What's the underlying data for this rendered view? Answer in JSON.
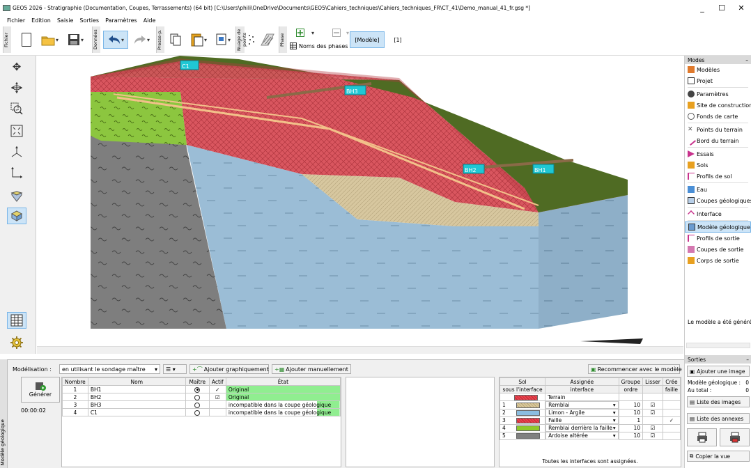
{
  "window": {
    "title": "GEO5 2026 - Stratigraphie (Documentation, Coupes, Terrassements) (64 bit) [C:\\Users\\phili\\OneDrive\\Documents\\GEO5\\Cahiers_techniques\\Cahiers_techniques_FR\\CT_41\\Demo_manual_41_fr.gsg *]",
    "minimize": "_",
    "maximize": "☐",
    "close": "✕"
  },
  "menu": [
    "Fichier",
    "Edition",
    "Saisie",
    "Sorties",
    "Paramètres",
    "Aide"
  ],
  "toolbar": {
    "group_fichier": "Fichier",
    "group_donnees": "Données",
    "group_presse": "Presse-p.",
    "nuage_label": "Nuage de points",
    "group_phase": "Phase",
    "phase_names_label": "Noms des phases",
    "mode_button": "[Modèle]",
    "phase_number": "[1]"
  },
  "view": {
    "boreholes": [
      "C1",
      "BH3",
      "BH2",
      "BH1"
    ]
  },
  "right_panel": {
    "modes_header": "Modes",
    "items": [
      {
        "label": "Modèles",
        "icon": "models-icon"
      },
      {
        "label": "Projet",
        "icon": "project-icon"
      },
      {
        "label": "Paramètres",
        "icon": "gear-icon"
      },
      {
        "label": "Site de construction",
        "icon": "site-icon"
      },
      {
        "label": "Fonds de carte",
        "icon": "map-icon"
      },
      {
        "label": "Points du terrain",
        "icon": "terrain-points-icon"
      },
      {
        "label": "Bord du terrain",
        "icon": "terrain-edge-icon"
      },
      {
        "label": "Essais",
        "icon": "tests-icon"
      },
      {
        "label": "Sols",
        "icon": "soils-icon"
      },
      {
        "label": "Profils de sol",
        "icon": "soil-profiles-icon"
      },
      {
        "label": "Eau",
        "icon": "water-icon"
      },
      {
        "label": "Coupes géologiques",
        "icon": "geological-sections-icon"
      },
      {
        "label": "Interface",
        "icon": "interface-icon"
      },
      {
        "label": "Modèle géologique",
        "icon": "geological-model-icon"
      },
      {
        "label": "Profils de sortie",
        "icon": "output-profiles-icon"
      },
      {
        "label": "Coupes de sortie",
        "icon": "output-sections-icon"
      },
      {
        "label": "Corps de sortie",
        "icon": "output-bodies-icon"
      }
    ],
    "message": "Le modèle a été généré.",
    "sorties_header": "Sorties",
    "add_image": "Ajouter une image",
    "model_label": "Modèle géologique :",
    "model_count": "0",
    "total_label": "Au total :",
    "total_count": "0",
    "image_list": "Liste des images",
    "annex_list": "Liste des annexes",
    "copy_view": "Copier la vue"
  },
  "bottom": {
    "side_tab": "Modèle géologique",
    "generate": "Générer",
    "elapsed": "00:00:02",
    "modelisation_label": "Modélisation :",
    "modelisation_value": "en utilisant le sondage maître",
    "add_graphic": "Ajouter graphiquement",
    "add_manual": "Ajouter manuellement",
    "restart": "Recommencer avec le modèle",
    "boreholes_table": {
      "headers": [
        "Nombre",
        "Nom",
        "Maître",
        "Actif",
        "État"
      ],
      "rows": [
        {
          "n": "1",
          "name": "BH1",
          "master": true,
          "active": "✓",
          "state": "Original"
        },
        {
          "n": "2",
          "name": "BH2",
          "master": false,
          "active": "☑",
          "state": "Original"
        },
        {
          "n": "3",
          "name": "BH3",
          "master": false,
          "active": "",
          "state": "incompatible dans la coupe géologique"
        },
        {
          "n": "4",
          "name": "C1",
          "master": false,
          "active": "",
          "state": "incompatible dans la coupe géologique"
        }
      ]
    },
    "interfaces_table": {
      "headers": [
        "Sol",
        "Assignée",
        "Groupe",
        "Lisser",
        "Crée"
      ],
      "subheaders": [
        "sous l'interface",
        "interface",
        "ordre",
        "",
        "faille"
      ],
      "rows": [
        {
          "n": "",
          "soil": "Terrain",
          "order": "",
          "smooth": "",
          "fault": "",
          "color": "#e8434f"
        },
        {
          "n": "1",
          "soil": "Remblai",
          "order": "10",
          "smooth": "☑",
          "fault": "",
          "color": "#d9c89a"
        },
        {
          "n": "2",
          "soil": "Limon - Argile",
          "order": "10",
          "smooth": "☑",
          "fault": "",
          "color": "#8bbde0"
        },
        {
          "n": "3",
          "soil": "Faille",
          "order": "1",
          "smooth": "",
          "fault": "✓",
          "color": "#e8434f"
        },
        {
          "n": "4",
          "soil": "Remblai derrière la faille",
          "order": "10",
          "smooth": "☑",
          "fault": "",
          "color": "#8ec92a"
        },
        {
          "n": "5",
          "soil": "Ardoise altérée",
          "order": "10",
          "smooth": "☑",
          "fault": "",
          "color": "#808080"
        }
      ],
      "footer": "Toutes les interfaces sont assignées."
    }
  }
}
